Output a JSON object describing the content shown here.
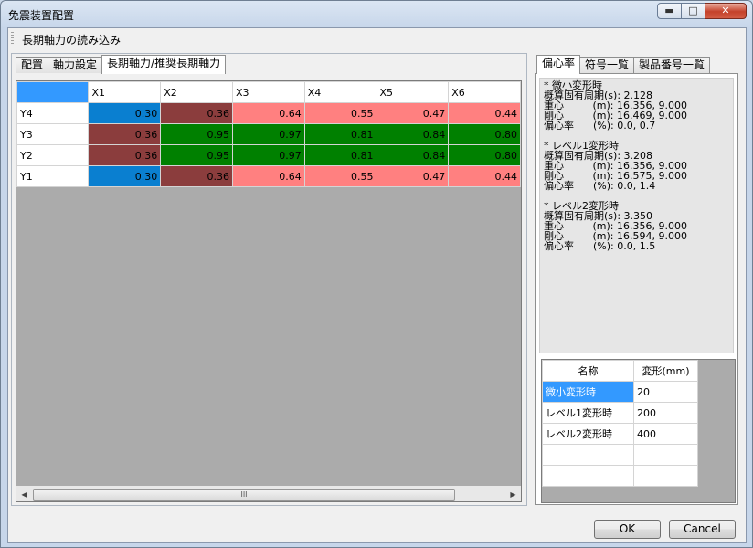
{
  "window": {
    "title": "免震装置配置"
  },
  "toolbar": {
    "load_label": "長期軸力の読み込み"
  },
  "left_tabs": [
    {
      "label": "配置"
    },
    {
      "label": "軸力設定"
    },
    {
      "label": "長期軸力/推奨長期軸力"
    }
  ],
  "grid": {
    "columns": [
      "X1",
      "X2",
      "X3",
      "X4",
      "X5",
      "X6"
    ],
    "rows": [
      {
        "label": "Y4",
        "cells": [
          {
            "value": "0.30",
            "color": "#0a7fd0"
          },
          {
            "value": "0.36",
            "color": "#8b3d3d"
          },
          {
            "value": "0.64",
            "color": "#ff8080"
          },
          {
            "value": "0.55",
            "color": "#ff8080"
          },
          {
            "value": "0.47",
            "color": "#ff8080"
          },
          {
            "value": "0.44",
            "color": "#ff8080"
          }
        ]
      },
      {
        "label": "Y3",
        "cells": [
          {
            "value": "0.36",
            "color": "#8b3d3d"
          },
          {
            "value": "0.95",
            "color": "#008000"
          },
          {
            "value": "0.97",
            "color": "#008000"
          },
          {
            "value": "0.81",
            "color": "#008000"
          },
          {
            "value": "0.84",
            "color": "#008000"
          },
          {
            "value": "0.80",
            "color": "#008000"
          }
        ]
      },
      {
        "label": "Y2",
        "cells": [
          {
            "value": "0.36",
            "color": "#8b3d3d"
          },
          {
            "value": "0.95",
            "color": "#008000"
          },
          {
            "value": "0.97",
            "color": "#008000"
          },
          {
            "value": "0.81",
            "color": "#008000"
          },
          {
            "value": "0.84",
            "color": "#008000"
          },
          {
            "value": "0.80",
            "color": "#008000"
          }
        ]
      },
      {
        "label": "Y1",
        "cells": [
          {
            "value": "0.30",
            "color": "#0a7fd0"
          },
          {
            "value": "0.36",
            "color": "#8b3d3d"
          },
          {
            "value": "0.64",
            "color": "#ff8080"
          },
          {
            "value": "0.55",
            "color": "#ff8080"
          },
          {
            "value": "0.47",
            "color": "#ff8080"
          },
          {
            "value": "0.44",
            "color": "#ff8080"
          }
        ]
      }
    ],
    "selected_color": "#3399ff",
    "scroll_thumb_glyph": "III"
  },
  "right_tabs": [
    {
      "label": "偏心率"
    },
    {
      "label": "符号一覧"
    },
    {
      "label": "製品番号一覧"
    }
  ],
  "info_lines": [
    "* 微小変形時",
    "概算固有周期(s): 2.128",
    "重心         (m): 16.356, 9.000",
    "剛心         (m): 16.469, 9.000",
    "偏心率      (%): 0.0, 0.7",
    "",
    "* レベル1変形時",
    "概算固有周期(s): 3.208",
    "重心         (m): 16.356, 9.000",
    "剛心         (m): 16.575, 9.000",
    "偏心率      (%): 0.0, 1.4",
    "",
    "* レベル2変形時",
    "概算固有周期(s): 3.350",
    "重心         (m): 16.356, 9.000",
    "剛心         (m): 16.594, 9.000",
    "偏心率      (%): 0.0, 1.5"
  ],
  "deform_table": {
    "headers": [
      "名称",
      "変形(mm)"
    ],
    "rows": [
      {
        "name": "微小変形時",
        "value": "20"
      },
      {
        "name": "レベル1変形時",
        "value": "200"
      },
      {
        "name": "レベル2変形時",
        "value": "400"
      },
      {
        "name": "",
        "value": ""
      },
      {
        "name": "",
        "value": ""
      }
    ]
  },
  "buttons": {
    "ok": "OK",
    "cancel": "Cancel"
  }
}
